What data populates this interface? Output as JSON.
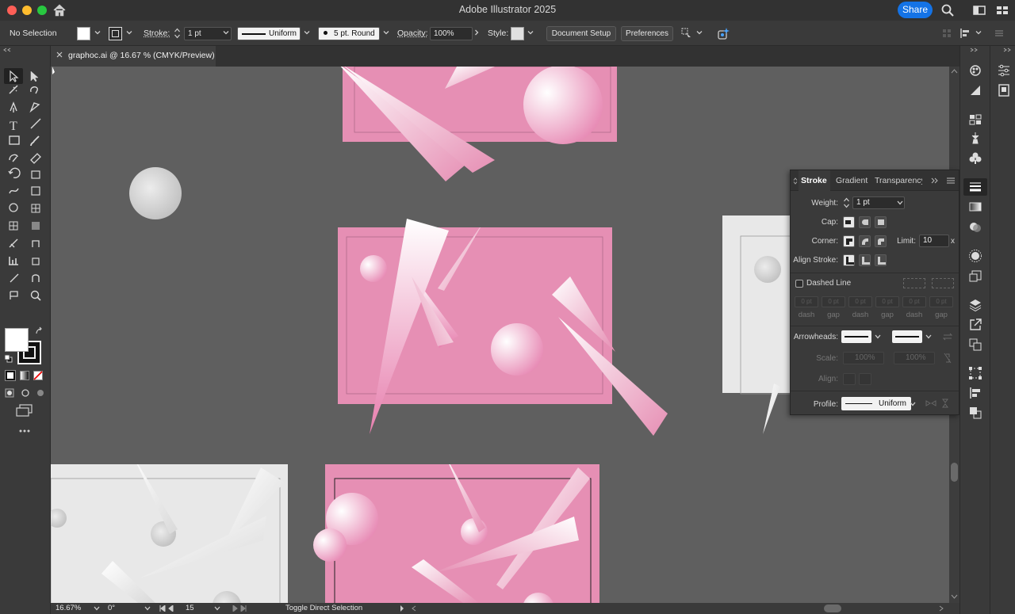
{
  "app": {
    "title": "Adobe Illustrator 2025",
    "share_label": "Share"
  },
  "control_bar": {
    "selection": "No Selection",
    "stroke_label": "Stroke:",
    "stroke_weight": "1 pt",
    "stroke_profile": "Uniform",
    "brush": "5 pt. Round",
    "opacity_label": "Opacity:",
    "opacity_value": "100%",
    "style_label": "Style:",
    "document_setup": "Document Setup",
    "preferences": "Preferences"
  },
  "document_tab": {
    "name": "graphoc.ai @ 16.67 % (CMYK/Preview)"
  },
  "status_bar": {
    "zoom": "16.67%",
    "rotation": "0°",
    "artboard_number": "15",
    "current_tool": "Toggle Direct Selection"
  },
  "stroke_panel": {
    "tabs": [
      "Stroke",
      "Gradient",
      "Transparency"
    ],
    "weight_label": "Weight:",
    "weight_value": "1 pt",
    "cap_label": "Cap:",
    "corner_label": "Corner:",
    "limit_label": "Limit:",
    "limit_value": "10",
    "limit_unit": "x",
    "align_label": "Align Stroke:",
    "dashed_line_label": "Dashed Line",
    "dash_placeholder": "0 pt",
    "dash_labels": [
      "dash",
      "gap",
      "dash",
      "gap",
      "dash",
      "gap"
    ],
    "arrowheads_label": "Arrowheads:",
    "scale_label": "Scale:",
    "scale_value": "100%",
    "align_arrow_label": "Align:",
    "profile_label": "Profile:",
    "profile_value": "Uniform"
  },
  "colors": {
    "canvas": "#5f5f5f",
    "artboard_pink": "#e68fb4",
    "artboard_gray": "#e8e8e8",
    "accent": "#1473e6"
  }
}
